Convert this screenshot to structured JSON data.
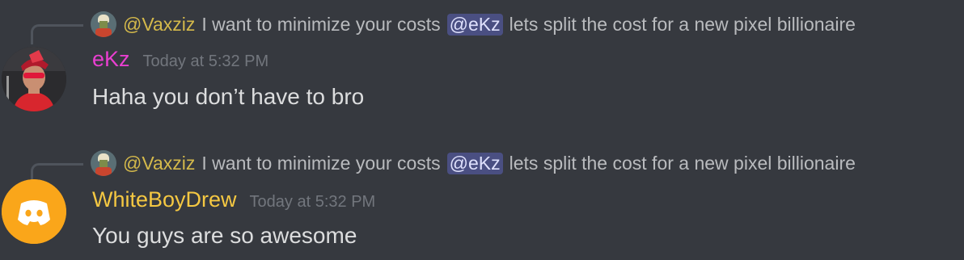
{
  "messages": [
    {
      "reply": {
        "author": "@Vaxziz",
        "text_before": "I want to minimize your costs",
        "mention": "@eKz",
        "text_after": "lets split the cost for a new pixel billionaire"
      },
      "author": "eKz",
      "author_color": "#e93fd0",
      "timestamp": "Today at 5:32 PM",
      "content": "Haha you don’t have to bro"
    },
    {
      "reply": {
        "author": "@Vaxziz",
        "text_before": "I want to minimize your costs",
        "mention": "@eKz",
        "text_after": "lets split the cost for a new pixel billionaire"
      },
      "author": "WhiteBoyDrew",
      "author_color": "#f5c842",
      "timestamp": "Today at 5:32 PM",
      "content": "You guys are so awesome"
    }
  ],
  "colors": {
    "background": "#36393f",
    "mention_bg": "#4a4f82",
    "discord_default_avatar": "#faa61a"
  }
}
